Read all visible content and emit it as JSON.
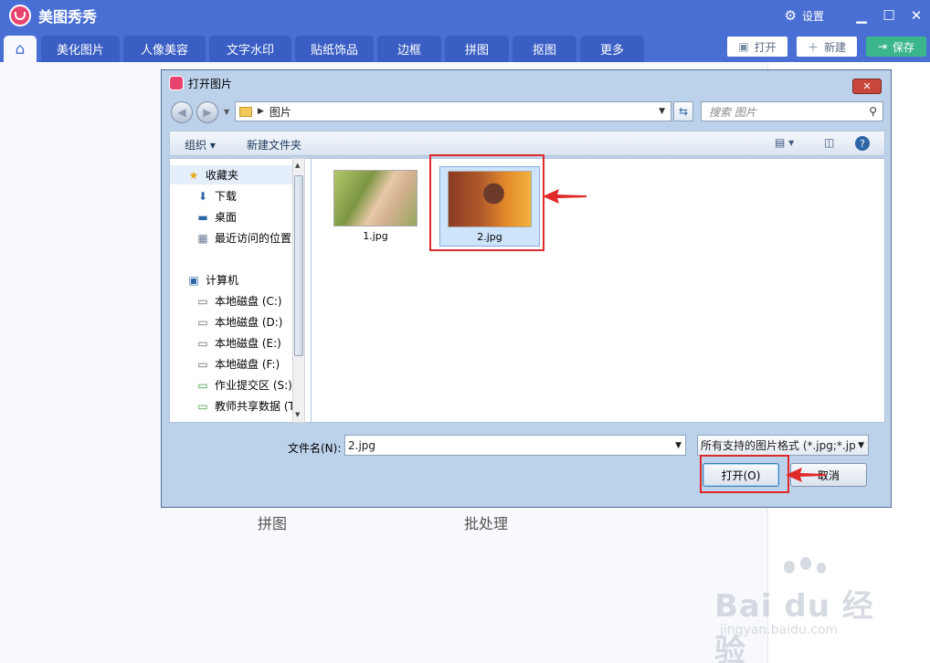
{
  "app": {
    "title": "美图秀秀",
    "settings_label": "设置",
    "tabs": [
      "美化图片",
      "人像美容",
      "文字水印",
      "贴纸饰品",
      "边框",
      "拼图",
      "抠图",
      "更多"
    ],
    "header_buttons": {
      "open": "打开",
      "new": "新建",
      "save": "保存"
    },
    "bg_labels": [
      "拼图",
      "批处理"
    ],
    "accent": "#4a6fd4",
    "save_color": "#3bb58c"
  },
  "dialog": {
    "title": "打开图片",
    "address": "图片",
    "search_placeholder": "搜索 图片",
    "commands": {
      "organize": "组织 ▾",
      "new_folder": "新建文件夹"
    },
    "nav": {
      "favorites": "收藏夹",
      "favorite_items": [
        "下载",
        "桌面",
        "最近访问的位置"
      ],
      "computer": "计算机",
      "drives": [
        "本地磁盘 (C:)",
        "本地磁盘 (D:)",
        "本地磁盘 (E:)",
        "本地磁盘 (F:)",
        "作业提交区 (S:)",
        "教师共享数据 (T:"
      ]
    },
    "files": [
      {
        "name": "1.jpg",
        "selected": false
      },
      {
        "name": "2.jpg",
        "selected": true
      }
    ],
    "filename_label": "文件名(N):",
    "filename_value": "2.jpg",
    "filter": "所有支持的图片格式 (*.jpg;*.jp",
    "open_button": "打开(O)",
    "cancel_button": "取消",
    "highlight_color": "#e02929"
  },
  "watermark": {
    "brand": "Bai du 经验",
    "url": "jingyan.baidu.com"
  }
}
